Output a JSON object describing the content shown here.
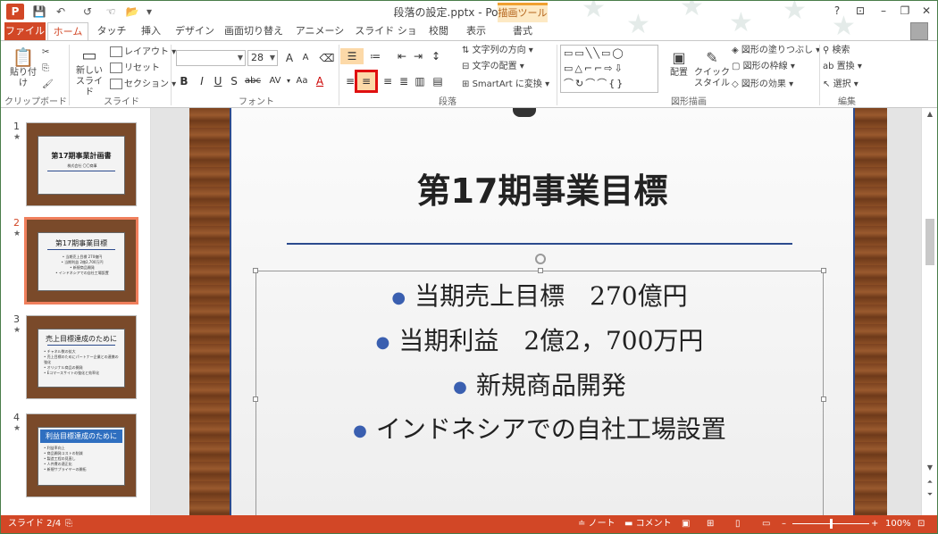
{
  "window": {
    "title": "段落の設定.pptx - PowerPoint",
    "contextual_tab": "描画ツール",
    "help": "?",
    "restore": "⊡",
    "minimize": "–",
    "maximize": "❐",
    "close": "✕"
  },
  "qat": {
    "logo": "P",
    "save": "💾",
    "undo": "↶",
    "redo": "↺",
    "touch": "☜",
    "open": "📂",
    "more": "▾"
  },
  "tabs": [
    "ファイル",
    "ホーム",
    "タッチ",
    "挿入",
    "デザイン",
    "画面切り替え",
    "アニメーション",
    "スライド ショー",
    "校閲",
    "表示",
    "書式"
  ],
  "ribbon": {
    "clipboard": {
      "paste": "貼り付け",
      "group": "クリップボード"
    },
    "slides": {
      "new_slide": "新しい",
      "new_slide2": "スライド",
      "layout": "レイアウト",
      "reset": "リセット",
      "section": "セクション",
      "group": "スライド"
    },
    "font": {
      "font_name": "",
      "font_size": "28",
      "group": "フォント",
      "bold": "B",
      "italic": "I",
      "underline": "U",
      "shadow": "S",
      "strike": "abc",
      "spacing": "AV",
      "case": "Aa",
      "color": "A",
      "grow": "A",
      "shrink": "A"
    },
    "paragraph": {
      "text_direction": "文字列の方向",
      "align_text": "文字の配置",
      "smartart": "SmartArt に変換",
      "group": "段落"
    },
    "drawing": {
      "arrange": "配置",
      "quick_styles": "クイック",
      "quick_styles2": "スタイル",
      "fill": "図形の塗りつぶし",
      "outline": "図形の枠線",
      "effects": "図形の効果",
      "group": "図形描画"
    },
    "editing": {
      "find": "検索",
      "replace": "置換",
      "select": "選択",
      "group": "編集"
    }
  },
  "thumbnails": [
    {
      "num": "1",
      "title": "第17期事業計画書",
      "sub": "株式会社 〇〇商事"
    },
    {
      "num": "2",
      "title": "第17期事業目標",
      "lines": [
        "• 当期売上目標 270億円",
        "• 当期利益 2億2,700万円",
        "• 新規商品開発",
        "• インドネシアでの自社工場設置"
      ]
    },
    {
      "num": "3",
      "title": "売上目標達成のために",
      "lines": [
        "• チャネル数の拡大",
        "• 売上目標のためにパートナー企業との連携の強化",
        "• オリジナル商品の開発",
        "• Eコマースサイトの強化と効率化"
      ]
    },
    {
      "num": "4",
      "title": "利益目標達成のために",
      "lines": [
        "• 利益率向上",
        "• 商品開発コストの削減",
        "• 製造工程の見直し",
        "• 人件費の適正化",
        "• 新規サプライヤーの開拓"
      ]
    }
  ],
  "slide": {
    "title": "第17期事業目標",
    "bullets": [
      "当期売上目標　270億円",
      "当期利益　2億2，700万円",
      "新規商品開発",
      "インドネシアでの自社工場設置"
    ]
  },
  "status": {
    "slide_indicator": "スライド 2/4",
    "notes": "ノート",
    "comments": "コメント",
    "zoom": "100%",
    "zoom_level": 0.5
  }
}
